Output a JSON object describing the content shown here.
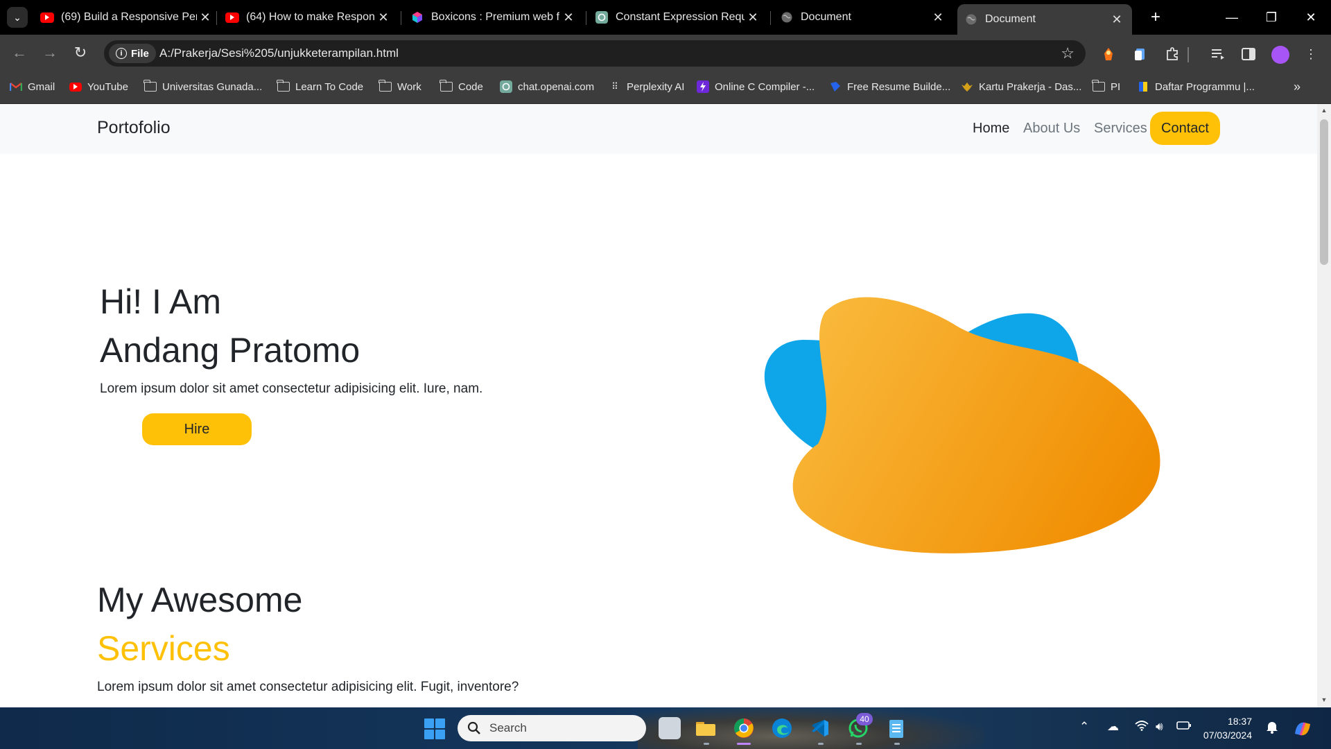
{
  "browser": {
    "tabs": [
      {
        "title": "(69) Build a Responsive Per",
        "icon": "youtube-icon"
      },
      {
        "title": "(64) How to make Respons",
        "icon": "youtube-icon"
      },
      {
        "title": "Boxicons : Premium web fr",
        "icon": "boxicons-icon"
      },
      {
        "title": "Constant Expression Requi",
        "icon": "chatgpt-icon"
      },
      {
        "title": "Document",
        "icon": "globe-icon"
      },
      {
        "title": "Document",
        "icon": "globe-icon",
        "active": true
      }
    ],
    "address": {
      "scheme_chip": "File",
      "url": "A:/Prakerja/Sesi%205/unjukketerampilan.html"
    },
    "bookmarks": [
      "Gmail",
      "YouTube",
      "Universitas Gunada...",
      "Learn To Code",
      "Work",
      "Code",
      "chat.openai.com",
      "Perplexity AI",
      "Online C Compiler -...",
      "Free Resume Builde...",
      "Kartu Prakerja - Das...",
      "PI",
      "Daftar Programmu |..."
    ]
  },
  "page": {
    "brand": "Portofolio",
    "nav": {
      "home": "Home",
      "about": "About Us",
      "services": "Services",
      "contact": "Contact"
    },
    "hero": {
      "line1": "Hi! I Am",
      "line2": "Andang Pratomo",
      "subtitle": "Lorem ipsum dolor sit amet consectetur adipisicing elit. Iure, nam.",
      "cta": "Hire"
    },
    "services": {
      "title_line1": "My Awesome",
      "title_line2": "Services",
      "subtitle": "Lorem ipsum dolor sit amet consectetur adipisicing elit. Fugit, inventore?"
    },
    "colors": {
      "accent": "#ffc107",
      "blob_blue": "#0ea5e9",
      "blob_orange": "#f59e0b"
    }
  },
  "taskbar": {
    "search_placeholder": "Search",
    "whatsapp_badge": "40",
    "time": "18:37",
    "date": "07/03/2024"
  }
}
